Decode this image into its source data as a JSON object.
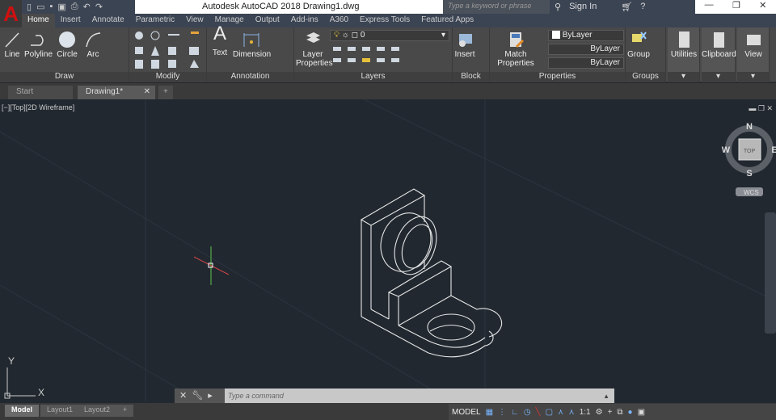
{
  "app": {
    "logo": "A",
    "title": "Autodesk AutoCAD 2018    Drawing1.dwg"
  },
  "search": {
    "placeholder": "Type a keyword or phrase"
  },
  "account": {
    "sign_in": "Sign In"
  },
  "tabs": [
    "Home",
    "Insert",
    "Annotate",
    "Parametric",
    "View",
    "Manage",
    "Output",
    "Add-ins",
    "A360",
    "Express Tools",
    "Featured Apps"
  ],
  "ribbon": {
    "draw": {
      "label": "Draw",
      "items": [
        "Line",
        "Polyline",
        "Circle",
        "Arc"
      ]
    },
    "modify": {
      "label": "Modify"
    },
    "annotation": {
      "label": "Annotation",
      "items": [
        "Text",
        "Dimension"
      ]
    },
    "layers": {
      "label": "Layers",
      "layer_props": "Layer Properties",
      "current_layer": "0"
    },
    "block": {
      "label": "Block",
      "insert": "Insert"
    },
    "properties": {
      "label": "Properties",
      "match": "Match Properties",
      "color": "ByLayer",
      "linetype": "ByLayer",
      "lineweight": "ByLayer"
    },
    "groups": {
      "label": "Groups",
      "group": "Group"
    },
    "utilities": "Utilities",
    "clipboard": "Clipboard",
    "view": "View"
  },
  "doc_tabs": [
    "Start",
    "Drawing1*"
  ],
  "viewport": {
    "label": "[−][Top][2D Wireframe]"
  },
  "viewcube": {
    "n": "N",
    "s": "S",
    "e": "E",
    "w": "W",
    "face": "TOP",
    "wcs": "WCS"
  },
  "ucs": {
    "x": "X",
    "y": "Y"
  },
  "command": {
    "placeholder": "Type  a  command"
  },
  "layouts": [
    "Model",
    "Layout1",
    "Layout2"
  ],
  "status": {
    "model": "MODEL",
    "scale": "1:1"
  }
}
